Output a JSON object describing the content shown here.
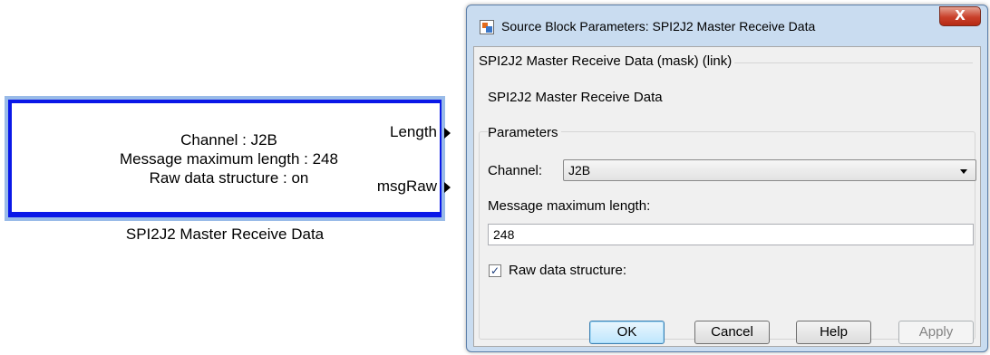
{
  "block": {
    "lines": [
      "Channel : J2B",
      "Message maximum length : 248",
      "Raw data structure : on"
    ],
    "ports": [
      "Length",
      "msgRaw"
    ],
    "caption": "SPI2J2 Master Receive Data"
  },
  "dialog": {
    "title": "Source Block Parameters: SPI2J2 Master Receive Data",
    "close_label": "X",
    "mask_group_label": "SPI2J2 Master Receive Data (mask) (link)",
    "mask_description": "SPI2J2 Master Receive Data",
    "parameters_label": "Parameters",
    "channel_label": "Channel:",
    "channel_value": "J2B",
    "length_label": "Message maximum length:",
    "length_value": "248",
    "raw_checked": true,
    "raw_label": "Raw data structure:",
    "buttons": {
      "ok": "OK",
      "cancel": "Cancel",
      "help": "Help",
      "apply": "Apply"
    }
  },
  "colors": {
    "block_border": "#0a18e8",
    "block_selection": "#99bbe8",
    "dialog_frame": "#c9dcf0"
  }
}
